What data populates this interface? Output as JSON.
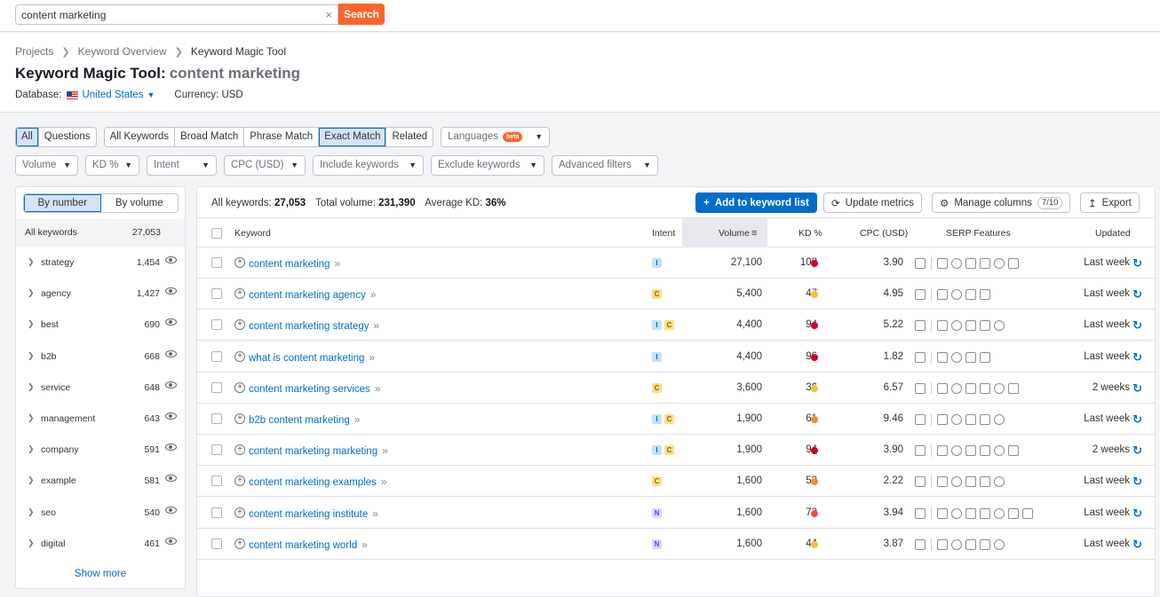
{
  "search": {
    "value": "content marketing",
    "button_label": "Search",
    "clear_icon": "×"
  },
  "breadcrumb": [
    "Projects",
    "Keyword Overview",
    "Keyword Magic Tool"
  ],
  "page": {
    "title": "Keyword Magic Tool:",
    "query": "content marketing"
  },
  "database": {
    "label": "Database:",
    "country": "United States",
    "currency_label": "Currency: USD"
  },
  "filters": {
    "type_tabs": [
      "All",
      "Questions"
    ],
    "match_tabs": [
      "All Keywords",
      "Broad Match",
      "Phrase Match",
      "Exact Match",
      "Related"
    ],
    "languages": {
      "label": "Languages",
      "badge": "beta"
    },
    "dropdowns": [
      "Volume",
      "KD %",
      "Intent",
      "CPC (USD)",
      "Include keywords",
      "Exclude keywords",
      "Advanced filters"
    ]
  },
  "sidebar": {
    "toggle": [
      "By number",
      "By volume"
    ],
    "all_label": "All keywords",
    "all_count": "27,053",
    "groups": [
      {
        "name": "strategy",
        "count": "1,454"
      },
      {
        "name": "agency",
        "count": "1,427"
      },
      {
        "name": "best",
        "count": "690"
      },
      {
        "name": "b2b",
        "count": "668"
      },
      {
        "name": "service",
        "count": "648"
      },
      {
        "name": "management",
        "count": "643"
      },
      {
        "name": "company",
        "count": "591"
      },
      {
        "name": "example",
        "count": "581"
      },
      {
        "name": "seo",
        "count": "540"
      },
      {
        "name": "digital",
        "count": "461"
      }
    ],
    "show_more": "Show more"
  },
  "summary": {
    "all_label": "All keywords:",
    "all_value": "27,053",
    "volume_label": "Total volume:",
    "volume_value": "231,390",
    "kd_label": "Average KD:",
    "kd_value": "36%"
  },
  "actions": {
    "add": "Add to keyword list",
    "update": "Update metrics",
    "manage": "Manage columns",
    "manage_badge": "7/10",
    "export": "Export"
  },
  "columns": [
    "Keyword",
    "Intent",
    "Volume",
    "KD %",
    "CPC (USD)",
    "SERP Features",
    "Updated"
  ],
  "rows": [
    {
      "keyword": "content marketing",
      "intent": [
        "I"
      ],
      "volume": "27,100",
      "kd": "100",
      "kd_color": "#d1002f",
      "cpc": "3.90",
      "updated": "Last week",
      "serp": 7
    },
    {
      "keyword": "content marketing agency",
      "intent": [
        "C"
      ],
      "volume": "5,400",
      "kd": "47",
      "kd_color": "#f6c137",
      "cpc": "4.95",
      "updated": "Last week",
      "serp": 5
    },
    {
      "keyword": "content marketing strategy",
      "intent": [
        "I",
        "C"
      ],
      "volume": "4,400",
      "kd": "94",
      "kd_color": "#d1002f",
      "cpc": "5.22",
      "updated": "Last week",
      "serp": 6
    },
    {
      "keyword": "what is content marketing",
      "intent": [
        "I"
      ],
      "volume": "4,400",
      "kd": "96",
      "kd_color": "#d1002f",
      "cpc": "1.82",
      "updated": "Last week",
      "serp": 5
    },
    {
      "keyword": "content marketing services",
      "intent": [
        "C"
      ],
      "volume": "3,600",
      "kd": "36",
      "kd_color": "#f6c137",
      "cpc": "6.57",
      "updated": "2 weeks",
      "serp": 7
    },
    {
      "keyword": "b2b content marketing",
      "intent": [
        "I",
        "C"
      ],
      "volume": "1,900",
      "kd": "61",
      "kd_color": "#f58b3c",
      "cpc": "9.46",
      "updated": "Last week",
      "serp": 6
    },
    {
      "keyword": "content marketing marketing",
      "intent": [
        "I",
        "C"
      ],
      "volume": "1,900",
      "kd": "94",
      "kd_color": "#d1002f",
      "cpc": "3.90",
      "updated": "2 weeks",
      "serp": 7
    },
    {
      "keyword": "content marketing examples",
      "intent": [
        "C"
      ],
      "volume": "1,600",
      "kd": "52",
      "kd_color": "#f58b3c",
      "cpc": "2.22",
      "updated": "Last week",
      "serp": 6
    },
    {
      "keyword": "content marketing institute",
      "intent": [
        "N"
      ],
      "volume": "1,600",
      "kd": "73",
      "kd_color": "#f24d4d",
      "cpc": "3.94",
      "updated": "Last week",
      "serp": 8
    },
    {
      "keyword": "content marketing world",
      "intent": [
        "N"
      ],
      "volume": "1,600",
      "kd": "44",
      "kd_color": "#f6c137",
      "cpc": "3.87",
      "updated": "Last week",
      "serp": 6
    }
  ]
}
